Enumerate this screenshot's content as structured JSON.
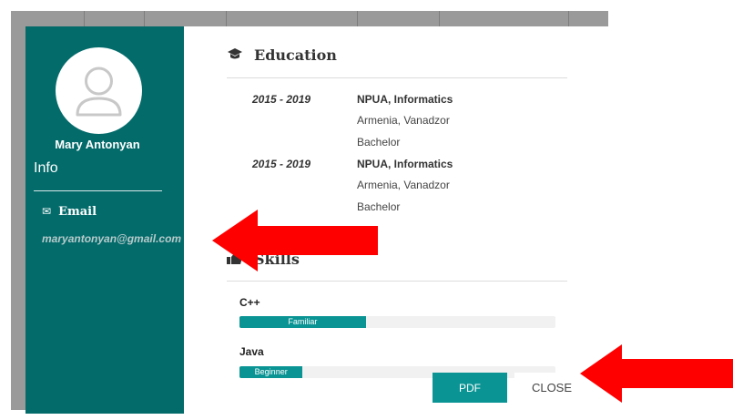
{
  "profile": {
    "name": "Mary Antonyan",
    "info_title": "Info",
    "email_label": "Email",
    "email_icon": "✉",
    "email": "maryantonyan@gmail.com"
  },
  "education": {
    "title": "Education",
    "icon": "graduation-cap-icon",
    "entries": [
      {
        "years": "2015 - 2019",
        "school": "NPUA, Informatics",
        "location": "Armenia, Vanadzor",
        "degree": "Bachelor"
      },
      {
        "years": "2015 - 2019",
        "school": "NPUA, Informatics",
        "location": "Armenia, Vanadzor",
        "degree": "Bachelor"
      }
    ]
  },
  "skills": {
    "title": "Skills",
    "icon": "thumbs-up-icon",
    "items": [
      {
        "name": "C++",
        "level": "Familiar",
        "percent": 40
      },
      {
        "name": "Java",
        "level": "Beginner",
        "percent": 20
      }
    ]
  },
  "buttons": {
    "pdf": "PDF",
    "close": "CLOSE"
  },
  "colors": {
    "sidebar": "#046b6b",
    "accent": "#0a9494",
    "annotation_arrow": "#ff0000"
  }
}
